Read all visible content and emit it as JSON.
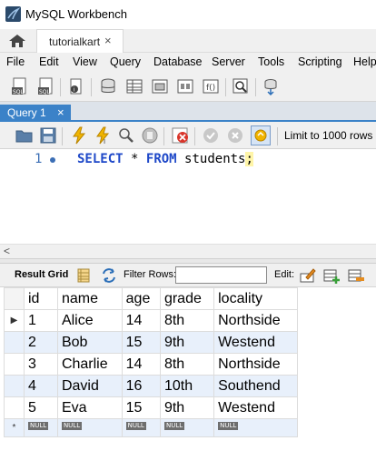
{
  "app": {
    "title": "MySQL Workbench"
  },
  "tabs": {
    "connection_tab": "tutorialkart",
    "close_glyph": "×"
  },
  "menu": [
    "File",
    "Edit",
    "View",
    "Query",
    "Database",
    "Server",
    "Tools",
    "Scripting",
    "Help"
  ],
  "query_tab": {
    "label": "Query 1",
    "close_glyph": "×"
  },
  "editor": {
    "line_number": "1",
    "tokens": {
      "kw1": "SELECT",
      "star": "*",
      "kw2": "FROM",
      "table": "students",
      "semicolon": ";"
    }
  },
  "editor_toolbar": {
    "limit_label": "Limit to 1000 rows"
  },
  "result_toolbar": {
    "result_grid_label": "Result Grid",
    "filter_label": "Filter Rows:",
    "filter_value": "",
    "edit_label": "Edit:"
  },
  "grid": {
    "columns": [
      "id",
      "name",
      "age",
      "grade",
      "locality"
    ],
    "rows": [
      [
        "1",
        "Alice",
        "14",
        "8th",
        "Northside"
      ],
      [
        "2",
        "Bob",
        "15",
        "9th",
        "Westend"
      ],
      [
        "3",
        "Charlie",
        "14",
        "8th",
        "Northside"
      ],
      [
        "4",
        "David",
        "16",
        "10th",
        "Southend"
      ],
      [
        "5",
        "Eva",
        "15",
        "9th",
        "Westend"
      ]
    ],
    "current_row_marker": "▶",
    "new_row_marker": "*",
    "null_badge": "NULL"
  },
  "colors": {
    "accent": "#3b82c8",
    "keyword": "#1e48c8",
    "row_alt": "#e8f0fb",
    "highlight": "#fff5a8"
  }
}
